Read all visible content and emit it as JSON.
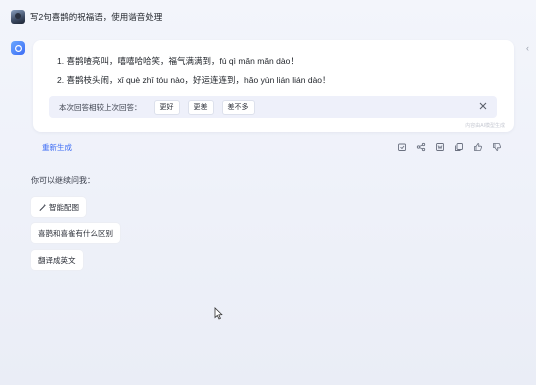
{
  "user_message": {
    "text": "写2句喜鹊的祝福语，使用谐音处理"
  },
  "answer": {
    "line1": "1. 喜鹊喳亮叫，嘻嘻哈哈笑，福气满满到，fú qì mǎn mǎn dào！",
    "line2": "2. 喜鹊枝头闹，xǐ què zhī tóu nào，好运连连到，hǎo yùn lián lián dào！",
    "watermark": "内容由AI模型生成"
  },
  "feedback": {
    "prompt": "本次回答相较上次回答：",
    "options": [
      "更好",
      "更差",
      "差不多"
    ]
  },
  "actions": {
    "regenerate_label": "重新生成"
  },
  "continue_section": {
    "title": "你可以继续问我：",
    "suggestions": [
      "智能配图",
      "喜鹊和喜雀有什么区别",
      "翻译成英文"
    ]
  },
  "icons": [
    "user-avatar",
    "bot-logo-icon",
    "close-icon",
    "copy-icon",
    "share-icon",
    "word-export-icon",
    "copy-text-icon",
    "thumbs-up-icon",
    "thumbs-down-icon",
    "magic-wand-icon",
    "chevron-left-icon",
    "mouse-cursor-icon"
  ],
  "colors": {
    "accent": "#3d6cf5",
    "background": "#f0f2f9",
    "card": "#ffffff",
    "feedback_bar": "#eef0fa"
  }
}
